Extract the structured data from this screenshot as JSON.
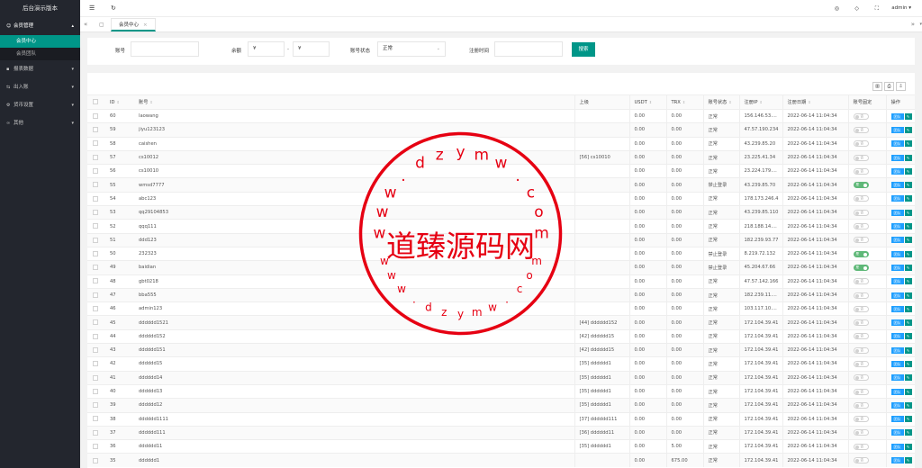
{
  "app": {
    "title": "后台演示版本"
  },
  "sidebar": {
    "menu": [
      {
        "icon": "user-icon",
        "glyph": "☺",
        "label": "会员管理",
        "open": true,
        "children": [
          {
            "label": "会员中心",
            "active": true
          },
          {
            "label": "会员团队",
            "active": false
          }
        ]
      },
      {
        "icon": "report-icon",
        "glyph": "▪",
        "label": "报表数据",
        "open": false,
        "children": []
      },
      {
        "icon": "inout-icon",
        "glyph": "⇆",
        "label": "出入账",
        "open": false,
        "children": []
      },
      {
        "icon": "currency-icon",
        "glyph": "⚙",
        "label": "货币设置",
        "open": false,
        "children": []
      },
      {
        "icon": "other-icon",
        "glyph": "∞",
        "label": "其他",
        "open": false,
        "children": []
      }
    ]
  },
  "header": {
    "user": "admin"
  },
  "tabs": {
    "items": [
      {
        "label": "会员中心"
      }
    ]
  },
  "filter": {
    "account_label": "账号",
    "balance_label": "余额",
    "currency_symbol_from": "¥",
    "range_sep": "-",
    "currency_symbol_to": "¥",
    "status_label": "账号状态",
    "status_value": "正常",
    "reg_time_label": "注册时间",
    "search_label": "搜索"
  },
  "table": {
    "columns": [
      "ID",
      "账号",
      "上级",
      "USDT",
      "TRX",
      "账号状态",
      "注册IP",
      "注册日期",
      "账号固定",
      "操作"
    ],
    "team_label": "团队",
    "switch_on": "是",
    "switch_off": "否",
    "rows": [
      {
        "id": "60",
        "account": "laowang",
        "parent": "",
        "usdt": "0.00",
        "trx": "0.00",
        "status": "正常",
        "ip": "156.146.53....",
        "date": "2022-06-14 11:04:34",
        "fixed": false
      },
      {
        "id": "59",
        "account": "jiyu123123",
        "parent": "",
        "usdt": "0.00",
        "trx": "0.00",
        "status": "正常",
        "ip": "47.57.190.234",
        "date": "2022-06-14 11:04:34",
        "fixed": false
      },
      {
        "id": "58",
        "account": "caishen",
        "parent": "",
        "usdt": "0.00",
        "trx": "0.00",
        "status": "正常",
        "ip": "43.239.85.20",
        "date": "2022-06-14 11:04:34",
        "fixed": false
      },
      {
        "id": "57",
        "account": "cs10012",
        "parent": "[56] cs10010",
        "usdt": "0.00",
        "trx": "0.00",
        "status": "正常",
        "ip": "23.225.41.34",
        "date": "2022-06-14 11:04:34",
        "fixed": false
      },
      {
        "id": "56",
        "account": "cs10010",
        "parent": "",
        "usdt": "0.00",
        "trx": "0.00",
        "status": "正常",
        "ip": "23.224.179....",
        "date": "2022-06-14 11:04:34",
        "fixed": false
      },
      {
        "id": "55",
        "account": "wmsd7777",
        "parent": "",
        "usdt": "0.00",
        "trx": "0.00",
        "status": "禁止登录",
        "ip": "43.239.85.70",
        "date": "2022-06-14 11:04:34",
        "fixed": true
      },
      {
        "id": "54",
        "account": "abc123",
        "parent": "",
        "usdt": "0.00",
        "trx": "0.00",
        "status": "正常",
        "ip": "178.173.246.4",
        "date": "2022-06-14 11:04:34",
        "fixed": false
      },
      {
        "id": "53",
        "account": "qq29104853",
        "parent": "",
        "usdt": "0.00",
        "trx": "0.00",
        "status": "正常",
        "ip": "43.239.85.110",
        "date": "2022-06-14 11:04:34",
        "fixed": false
      },
      {
        "id": "52",
        "account": "qqq111",
        "parent": "",
        "usdt": "0.00",
        "trx": "0.00",
        "status": "正常",
        "ip": "218.188.14....",
        "date": "2022-06-14 11:04:34",
        "fixed": false
      },
      {
        "id": "51",
        "account": "ddd123",
        "parent": "",
        "usdt": "0.00",
        "trx": "0.00",
        "status": "正常",
        "ip": "182.239.93.77",
        "date": "2022-06-14 11:04:34",
        "fixed": false
      },
      {
        "id": "50",
        "account": "232323",
        "parent": "",
        "usdt": "0.00",
        "trx": "0.00",
        "status": "禁止登录",
        "ip": "8.219.72.132",
        "date": "2022-06-14 11:04:34",
        "fixed": true
      },
      {
        "id": "49",
        "account": "baidian",
        "parent": "",
        "usdt": "0.00",
        "trx": "0.00",
        "status": "禁止登录",
        "ip": "45.204.67.66",
        "date": "2022-06-14 11:04:34",
        "fixed": true
      },
      {
        "id": "48",
        "account": "gbt0218",
        "parent": "",
        "usdt": "0.00",
        "trx": "0.00",
        "status": "正常",
        "ip": "47.57.142.166",
        "date": "2022-06-14 11:04:34",
        "fixed": false
      },
      {
        "id": "47",
        "account": "bba555",
        "parent": "",
        "usdt": "0.00",
        "trx": "0.00",
        "status": "正常",
        "ip": "182.239.11....",
        "date": "2022-06-14 11:04:34",
        "fixed": false
      },
      {
        "id": "46",
        "account": "admin123",
        "parent": "",
        "usdt": "0.00",
        "trx": "0.00",
        "status": "正常",
        "ip": "103.117.10....",
        "date": "2022-06-14 11:04:34",
        "fixed": false
      },
      {
        "id": "45",
        "account": "dddddd1521",
        "parent": "[44] dddddd152",
        "usdt": "0.00",
        "trx": "0.00",
        "status": "正常",
        "ip": "172.104.39.41",
        "date": "2022-06-14 11:04:34",
        "fixed": false
      },
      {
        "id": "44",
        "account": "dddddd152",
        "parent": "[42] dddddd15",
        "usdt": "0.00",
        "trx": "0.00",
        "status": "正常",
        "ip": "172.104.39.41",
        "date": "2022-06-14 11:04:34",
        "fixed": false
      },
      {
        "id": "43",
        "account": "dddddd151",
        "parent": "[42] dddddd15",
        "usdt": "0.00",
        "trx": "0.00",
        "status": "正常",
        "ip": "172.104.39.41",
        "date": "2022-06-14 11:04:34",
        "fixed": false
      },
      {
        "id": "42",
        "account": "dddddd15",
        "parent": "[35] dddddd1",
        "usdt": "0.00",
        "trx": "0.00",
        "status": "正常",
        "ip": "172.104.39.41",
        "date": "2022-06-14 11:04:34",
        "fixed": false
      },
      {
        "id": "41",
        "account": "dddddd14",
        "parent": "[35] dddddd1",
        "usdt": "0.00",
        "trx": "0.00",
        "status": "正常",
        "ip": "172.104.39.41",
        "date": "2022-06-14 11:04:34",
        "fixed": false
      },
      {
        "id": "40",
        "account": "dddddd13",
        "parent": "[35] dddddd1",
        "usdt": "0.00",
        "trx": "0.00",
        "status": "正常",
        "ip": "172.104.39.41",
        "date": "2022-06-14 11:04:34",
        "fixed": false
      },
      {
        "id": "39",
        "account": "dddddd12",
        "parent": "[35] dddddd1",
        "usdt": "0.00",
        "trx": "0.00",
        "status": "正常",
        "ip": "172.104.39.41",
        "date": "2022-06-14 11:04:34",
        "fixed": false
      },
      {
        "id": "38",
        "account": "dddddd1111",
        "parent": "[37] dddddd111",
        "usdt": "0.00",
        "trx": "0.00",
        "status": "正常",
        "ip": "172.104.39.41",
        "date": "2022-06-14 11:04:34",
        "fixed": false
      },
      {
        "id": "37",
        "account": "dddddd111",
        "parent": "[36] dddddd11",
        "usdt": "0.00",
        "trx": "0.00",
        "status": "正常",
        "ip": "172.104.39.41",
        "date": "2022-06-14 11:04:34",
        "fixed": false
      },
      {
        "id": "36",
        "account": "dddddd11",
        "parent": "[35] dddddd1",
        "usdt": "0.00",
        "trx": "5.00",
        "status": "正常",
        "ip": "172.104.39.41",
        "date": "2022-06-14 11:04:34",
        "fixed": false
      },
      {
        "id": "35",
        "account": "dddddd1",
        "parent": "",
        "usdt": "0.00",
        "trx": "675.00",
        "status": "正常",
        "ip": "172.104.39.41",
        "date": "2022-06-14 11:04:34",
        "fixed": false
      }
    ]
  },
  "watermark": {
    "text": "道臻源码网",
    "url": "www.dzymw.com",
    "color": "#e60012"
  }
}
